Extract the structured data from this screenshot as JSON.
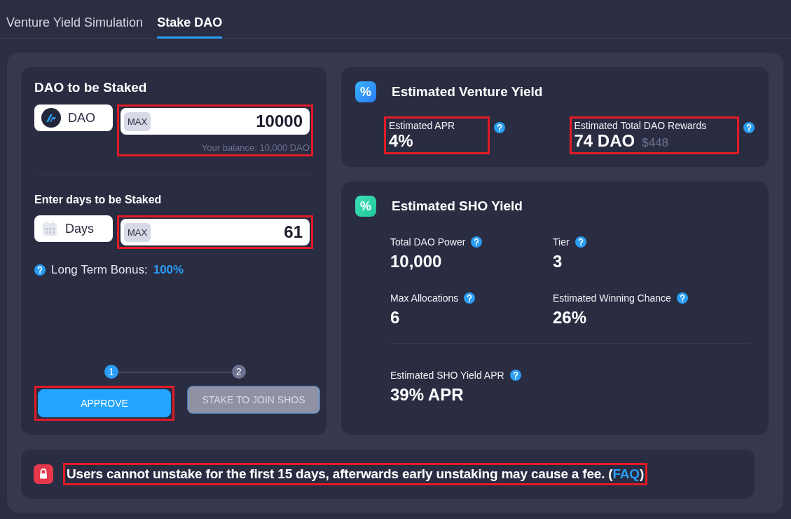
{
  "tabs": [
    {
      "label": "Venture Yield Simulation",
      "selected": false
    },
    {
      "label": "Stake DAO",
      "selected": true
    }
  ],
  "stake_card": {
    "title": "DAO to be Staked",
    "token": {
      "label": "DAO"
    },
    "amount": {
      "max_label": "MAX",
      "value": "10000",
      "balance": "Your balance: 10,000 DAO",
      "highlighted": true
    },
    "days_title": "Enter days to be Staked",
    "days": {
      "label": "Days"
    },
    "days_field": {
      "max_label": "MAX",
      "value": "61",
      "highlighted": true
    },
    "bonus": {
      "label": "Long Term Bonus:",
      "value": "100%"
    },
    "steps": [
      {
        "label": "1",
        "active": true
      },
      {
        "label": "2",
        "active": false
      }
    ],
    "buttons": [
      {
        "label": "APPROVE",
        "disabled": false,
        "highlighted": true
      },
      {
        "label": "STAKE TO JOIN SHOS",
        "disabled": true,
        "highlighted": false
      }
    ]
  },
  "venture": {
    "icon": "%",
    "title": "Estimated Venture Yield",
    "stats": [
      {
        "label": "Estimated APR",
        "value": "4%",
        "highlighted": true
      },
      {
        "label": "Estimated Total DAO Rewards",
        "value": "74 DAO",
        "secondary": "$448",
        "highlighted": true
      }
    ]
  },
  "sho": {
    "icon": "%",
    "title": "Estimated SHO Yield",
    "stats": [
      {
        "label": "Total DAO Power",
        "value": "10,000"
      },
      {
        "label": "Tier",
        "value": "3"
      },
      {
        "label": "Max Allocations",
        "value": "6"
      },
      {
        "label": "Estimated Winning Chance",
        "value": "26%"
      },
      {
        "label": "Estimated SHO Yield APR",
        "value": "39% APR"
      }
    ]
  },
  "notice": {
    "text": "Users cannot unstake for the first 15 days, afterwards early unstaking may cause a fee. (",
    "link": "FAQ",
    "suffix": ")",
    "highlighted": true
  }
}
